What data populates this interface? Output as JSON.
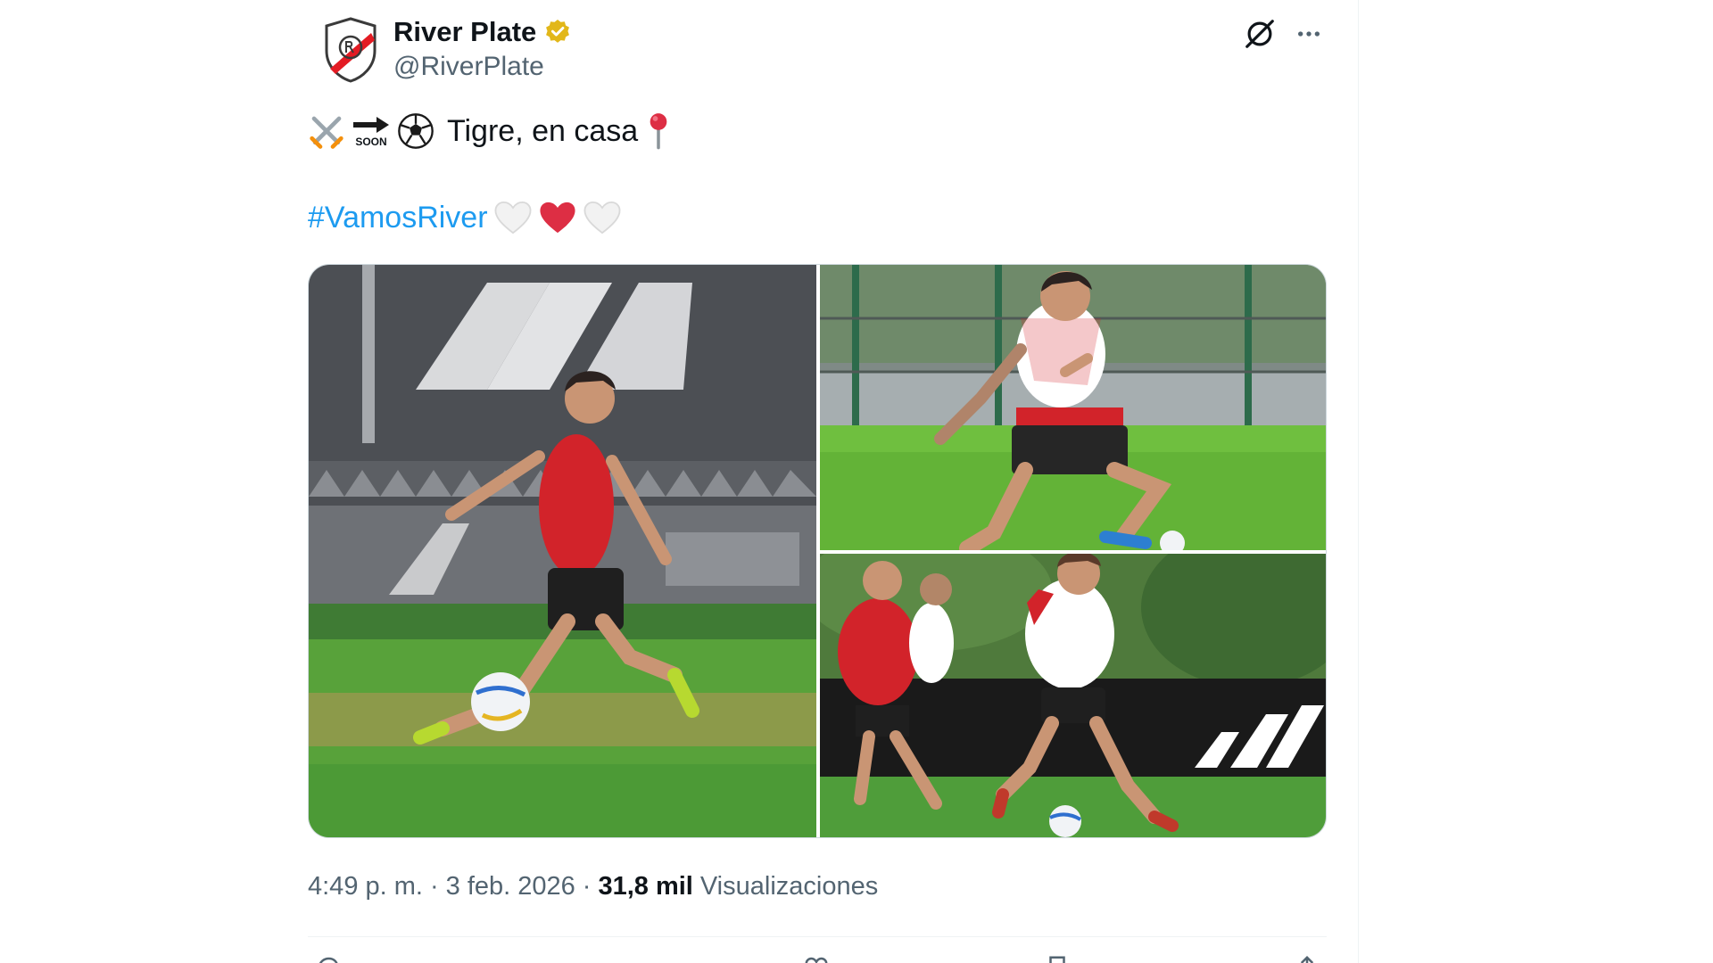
{
  "tweet": {
    "author_name": "River Plate",
    "author_handle": "@RiverPlate",
    "text_soon_label": "SOON",
    "text": "Tigre, en casa",
    "hashtag": "#VamosRiver",
    "timestamp": "4:49 p. m.",
    "date": "3 feb. 2026",
    "separator": "·",
    "views_count": "31,8 mil",
    "views_label": "Visualizaciones",
    "media_count": 3
  },
  "icons": {
    "verified": "verified-badge-icon",
    "grok": "grok-icon",
    "more": "more-icon",
    "swords": "crossed-swords-emoji",
    "soon_arrow": "soon-arrow-emoji",
    "soccer_ball": "soccer-ball-emoji",
    "pin": "round-pushpin-emoji",
    "white_heart": "white-heart-emoji",
    "red_heart": "red-heart-emoji"
  },
  "colors": {
    "text_primary": "#0f1419",
    "text_secondary": "#536471",
    "link": "#1d9bf0",
    "verified_gold": "#e2b719",
    "club_red": "#e31b23",
    "border": "#cfd9de"
  }
}
